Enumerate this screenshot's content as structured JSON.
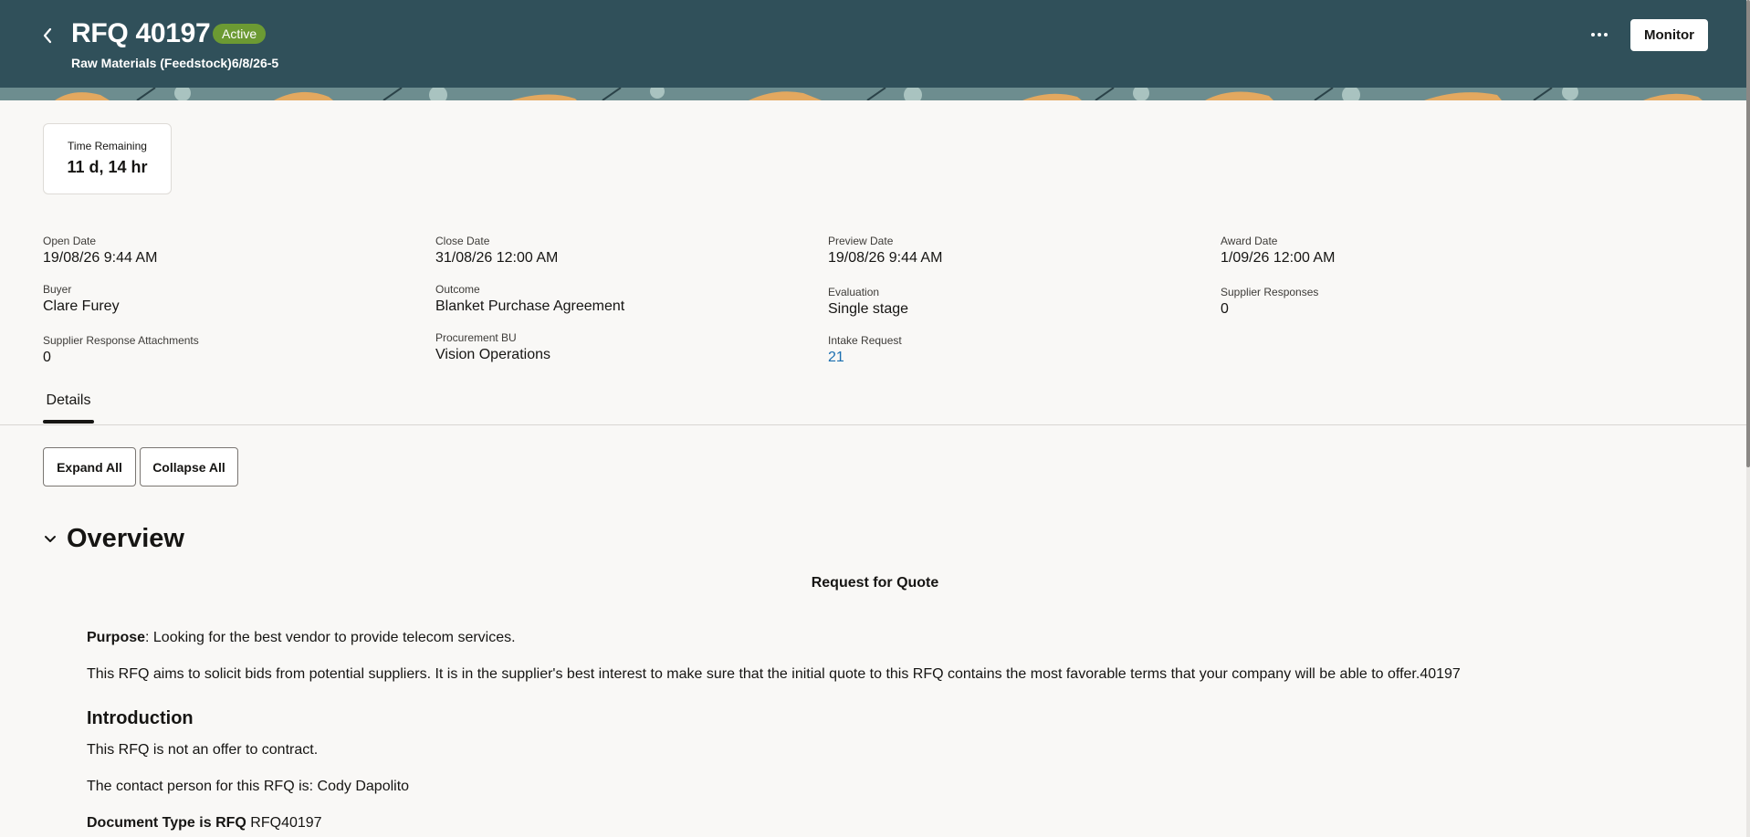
{
  "header": {
    "title": "RFQ 40197",
    "status_badge": "Active",
    "subtitle": "Raw Materials (Feedstock)6/8/26-5",
    "monitor_label": "Monitor",
    "colors": {
      "background": "#30505a",
      "badge": "#6c9a33"
    }
  },
  "time_remaining": {
    "label": "Time Remaining",
    "value": "11 d, 14 hr"
  },
  "fields": {
    "open_date": {
      "label": "Open Date",
      "value": "19/08/26 9:44 AM"
    },
    "close_date": {
      "label": "Close Date",
      "value": "31/08/26 12:00 AM"
    },
    "preview_date": {
      "label": "Preview Date",
      "value": "19/08/26 9:44 AM"
    },
    "award_date": {
      "label": "Award Date",
      "value": "1/09/26 12:00 AM"
    },
    "buyer": {
      "label": "Buyer",
      "value": "Clare Furey"
    },
    "outcome": {
      "label": "Outcome",
      "value": "Blanket Purchase Agreement"
    },
    "evaluation": {
      "label": "Evaluation",
      "value": "Single stage"
    },
    "supplier_responses": {
      "label": "Supplier Responses",
      "value": "0"
    },
    "supplier_response_attachments": {
      "label": "Supplier Response Attachments",
      "value": "0"
    },
    "procurement_bu": {
      "label": "Procurement BU",
      "value": "Vision Operations"
    },
    "intake_request": {
      "label": "Intake Request",
      "value": "21"
    }
  },
  "tabs": [
    {
      "label": "Details",
      "selected": true
    }
  ],
  "actions": {
    "expand_all": "Expand All",
    "collapse_all": "Collapse All"
  },
  "overview": {
    "section_title": "Overview",
    "heading": "Request for Quote",
    "purpose_label": "Purpose",
    "purpose_text": ": Looking for the best vendor to provide telecom services.",
    "aim_text": "This RFQ aims to solicit bids from potential suppliers. It is in the supplier's best interest to make sure that the initial quote to this RFQ contains the most favorable terms that your company will be able to offer.40197",
    "intro_heading": "Introduction",
    "intro_text": "This RFQ is not an offer to contract.",
    "contact_text": "The contact person for this RFQ is: Cody Dapolito",
    "doc_type_label": "Document Type is RFQ",
    "doc_type_value": " RFQ40197"
  },
  "icons": {
    "back": "chevron-left-icon",
    "more": "more-horizontal-icon",
    "section_toggle": "chevron-down-icon"
  },
  "colors": {
    "link": "#1b6fb0",
    "page_background": "#f9f8f6"
  }
}
